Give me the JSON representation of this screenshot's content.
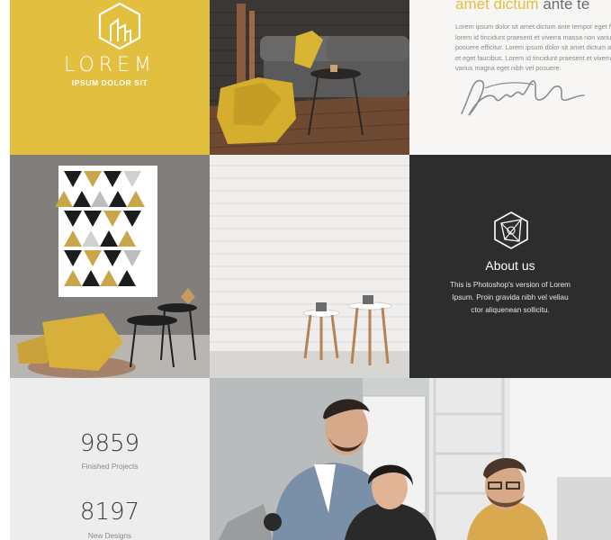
{
  "brand": {
    "title": "LOREM",
    "subtitle": "IPSUM DOLOR SIT",
    "color": "#e3bf3f"
  },
  "intro": {
    "heading_accent": "amet dictum",
    "heading_rest": " ante te",
    "lines": [
      "Lorem ipsum dolor sit amet dictum ante tempor eget faucib",
      "lorem id tincidunt praesent et viverra massa non varius magna",
      "posuere efficitur. Lorem ipsum dolor sit amet dictum ante tempor",
      "et eget faucibus. Lorem id tincidunt praesent et viverra massa non",
      "varius magna eget nibh vel posuere."
    ]
  },
  "about": {
    "title": "About us",
    "lines": [
      "This is Photoshop's version of Lorem",
      "Ipsum. Proin gravida nibh vel veliau",
      "ctor aliquenean sollicitu."
    ],
    "background": "#2e2d2d"
  },
  "stats": [
    {
      "value": "9859",
      "label": "Finished Projects"
    },
    {
      "value": "8197",
      "label": "New Designs"
    }
  ],
  "icons": {
    "brand": "hexagon-building-icon",
    "about": "hexagon-geometric-icon"
  }
}
